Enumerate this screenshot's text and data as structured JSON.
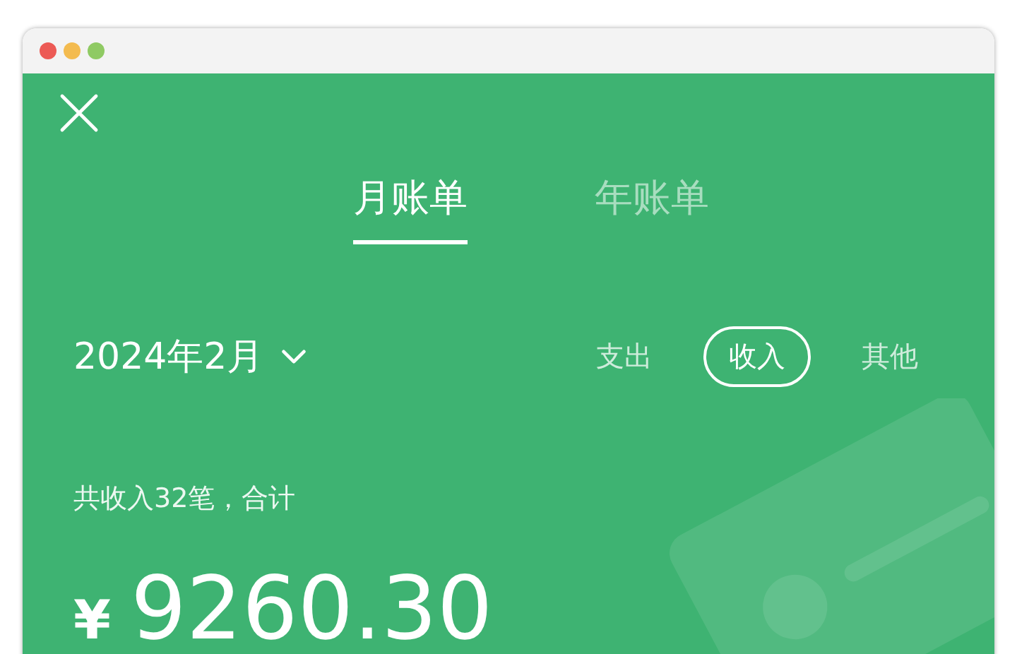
{
  "tabs": [
    {
      "label": "月账单",
      "selected": true
    },
    {
      "label": "年账单",
      "selected": false
    }
  ],
  "period": {
    "label": "2024年2月"
  },
  "filters": [
    {
      "label": "支出",
      "selected": false
    },
    {
      "label": "收入",
      "selected": true
    },
    {
      "label": "其他",
      "selected": false
    }
  ],
  "summary": {
    "text": "共收入32笔，合计",
    "currency": "¥",
    "amount": "9260.30"
  }
}
